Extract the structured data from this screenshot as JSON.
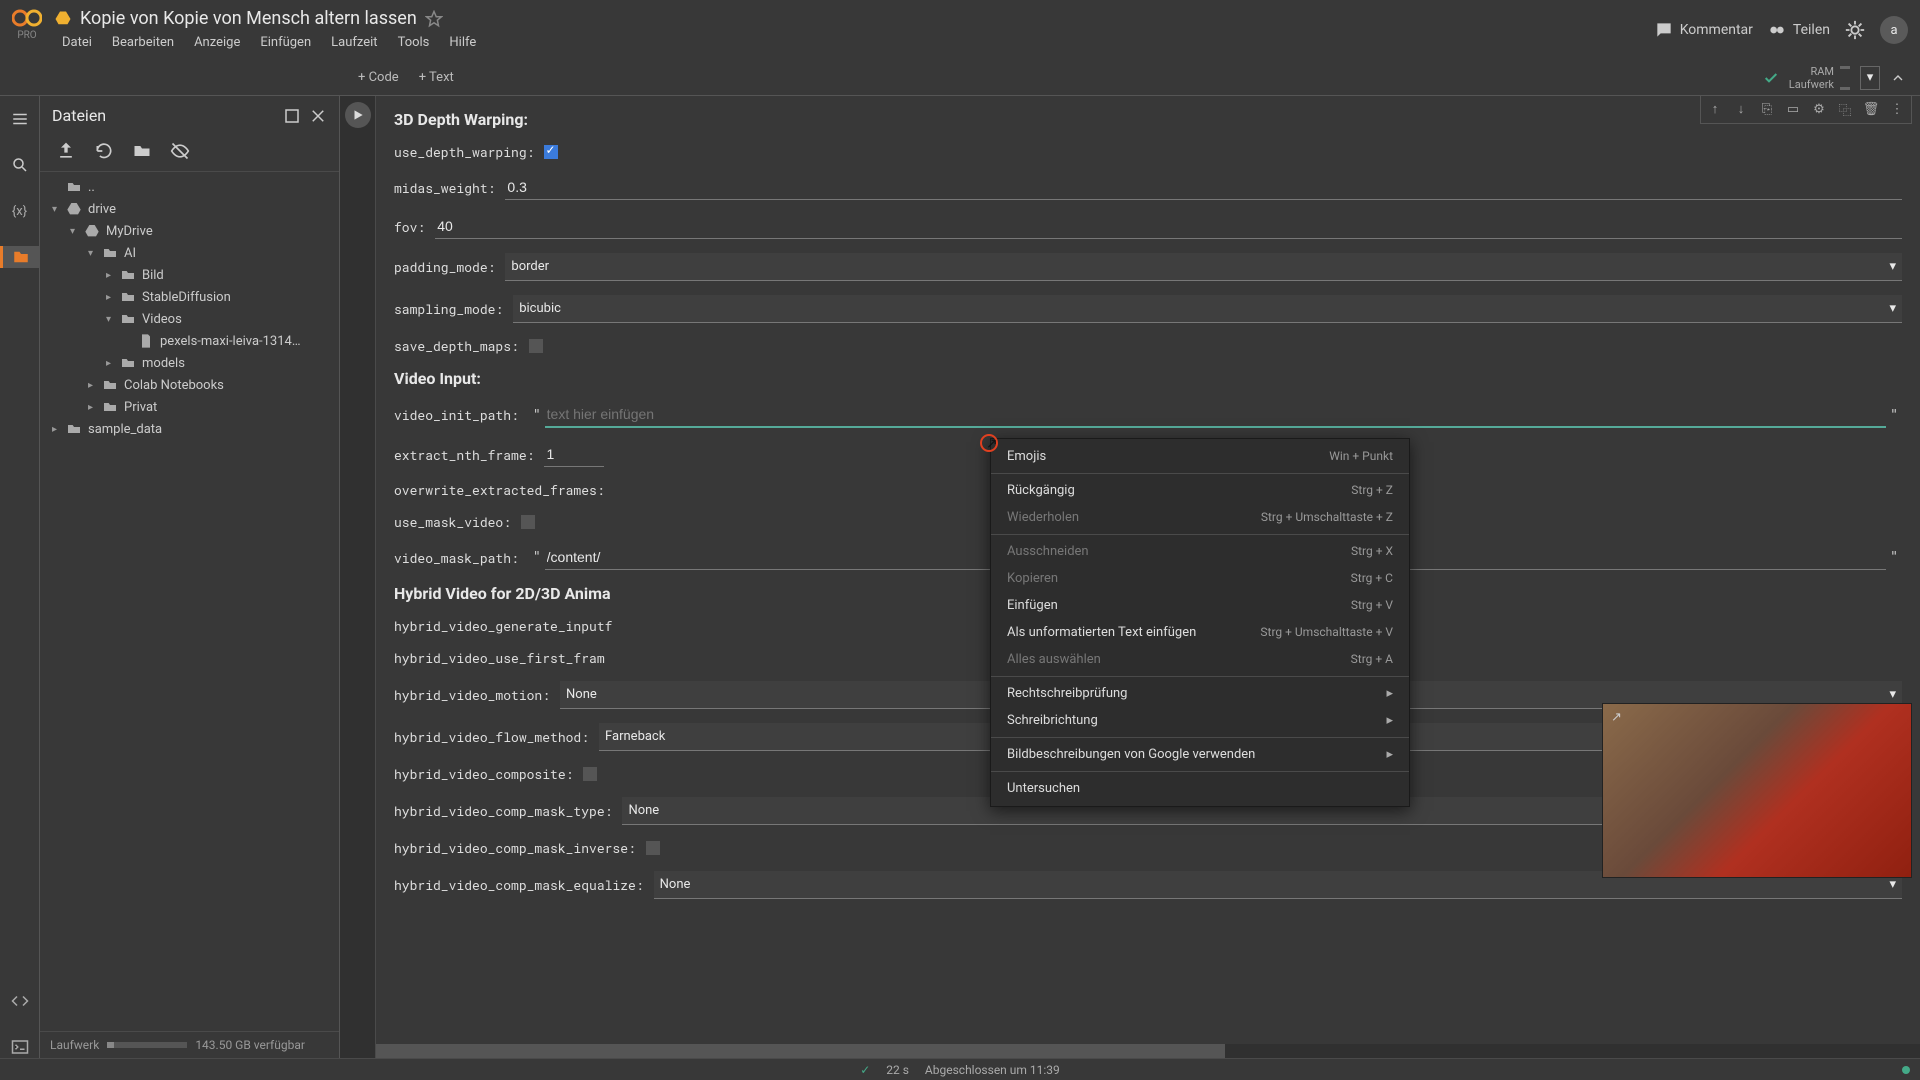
{
  "header": {
    "pro": "PRO",
    "title": "Kopie von Kopie von Mensch altern lassen",
    "menus": [
      "Datei",
      "Bearbeiten",
      "Anzeige",
      "Einfügen",
      "Laufzeit",
      "Tools",
      "Hilfe"
    ],
    "kommentar": "Kommentar",
    "teilen": "Teilen",
    "avatar": "a",
    "ram_label": "RAM",
    "laufwerk_label": "Laufwerk"
  },
  "toolbar": {
    "code": "+ Code",
    "text": "+ Text"
  },
  "files": {
    "title": "Dateien",
    "footer_label": "Laufwerk",
    "footer_free": "143.50 GB verfügbar",
    "tree": [
      {
        "depth": 0,
        "caret": "",
        "icon": "folder",
        "label": ".."
      },
      {
        "depth": 0,
        "caret": "▾",
        "icon": "drive",
        "label": "drive"
      },
      {
        "depth": 1,
        "caret": "▾",
        "icon": "drive",
        "label": "MyDrive"
      },
      {
        "depth": 2,
        "caret": "▾",
        "icon": "folder",
        "label": "AI"
      },
      {
        "depth": 3,
        "caret": "▸",
        "icon": "folder",
        "label": "Bild"
      },
      {
        "depth": 3,
        "caret": "▸",
        "icon": "folder",
        "label": "StableDiffusion"
      },
      {
        "depth": 3,
        "caret": "▾",
        "icon": "folder",
        "label": "Videos"
      },
      {
        "depth": 4,
        "caret": "",
        "icon": "file",
        "label": "pexels-maxi-leiva-1314…"
      },
      {
        "depth": 3,
        "caret": "▸",
        "icon": "folder",
        "label": "models"
      },
      {
        "depth": 2,
        "caret": "▸",
        "icon": "folder",
        "label": "Colab Notebooks"
      },
      {
        "depth": 2,
        "caret": "▸",
        "icon": "folder",
        "label": "Privat"
      },
      {
        "depth": 0,
        "caret": "▸",
        "icon": "folder",
        "label": "sample_data"
      }
    ]
  },
  "form": {
    "section1": "3D Depth Warping:",
    "use_depth_warping": "use_depth_warping:",
    "midas_weight": {
      "label": "midas_weight:",
      "value": "0.3"
    },
    "fov": {
      "label": "fov:",
      "value": "40"
    },
    "padding_mode": {
      "label": "padding_mode:",
      "value": "border"
    },
    "sampling_mode": {
      "label": "sampling_mode:",
      "value": "bicubic"
    },
    "save_depth_maps": "save_depth_maps:",
    "section2": "Video Input:",
    "video_init_path": {
      "label": "video_init_path:",
      "placeholder": "text hier einfügen"
    },
    "extract_nth_frame": {
      "label": "extract_nth_frame:",
      "value": "1"
    },
    "overwrite_extracted_frames": "overwrite_extracted_frames:",
    "use_mask_video": "use_mask_video:",
    "video_mask_path": {
      "label": "video_mask_path:",
      "value": "/content/"
    },
    "section3": "Hybrid Video for 2D/3D Anima",
    "hybrid_video_generate_inputf": "hybrid_video_generate_inputf",
    "hybrid_video_use_first_fram": "hybrid_video_use_first_fram",
    "hybrid_video_motion": {
      "label": "hybrid_video_motion:",
      "value": "None"
    },
    "hybrid_video_flow_method": {
      "label": "hybrid_video_flow_method:",
      "value": "Farneback"
    },
    "hybrid_video_composite": "hybrid_video_composite:",
    "hybrid_video_comp_mask_type": {
      "label": "hybrid_video_comp_mask_type:",
      "value": "None"
    },
    "hybrid_video_comp_mask_inverse": "hybrid_video_comp_mask_inverse:",
    "hybrid_video_comp_mask_equalize": {
      "label": "hybrid_video_comp_mask_equalize:",
      "value": "None"
    }
  },
  "context_menu": [
    {
      "type": "item",
      "label": "Emojis",
      "shortcut": "Win + Punkt"
    },
    {
      "type": "sep"
    },
    {
      "type": "item",
      "label": "Rückgängig",
      "shortcut": "Strg + Z"
    },
    {
      "type": "item",
      "label": "Wiederholen",
      "shortcut": "Strg + Umschalttaste + Z",
      "disabled": true
    },
    {
      "type": "sep"
    },
    {
      "type": "item",
      "label": "Ausschneiden",
      "shortcut": "Strg + X",
      "disabled": true
    },
    {
      "type": "item",
      "label": "Kopieren",
      "shortcut": "Strg + C",
      "disabled": true
    },
    {
      "type": "item",
      "label": "Einfügen",
      "shortcut": "Strg + V"
    },
    {
      "type": "item",
      "label": "Als unformatierten Text einfügen",
      "shortcut": "Strg + Umschalttaste + V"
    },
    {
      "type": "item",
      "label": "Alles auswählen",
      "shortcut": "Strg + A",
      "disabled": true
    },
    {
      "type": "sep"
    },
    {
      "type": "item",
      "label": "Rechtschreibprüfung",
      "arrow": true
    },
    {
      "type": "item",
      "label": "Schreibrichtung",
      "arrow": true
    },
    {
      "type": "sep"
    },
    {
      "type": "item",
      "label": "Bildbeschreibungen von Google verwenden",
      "arrow": true
    },
    {
      "type": "sep"
    },
    {
      "type": "item",
      "label": "Untersuchen"
    }
  ],
  "status": {
    "time": "22 s",
    "completed": "Abgeschlossen um 11:39"
  }
}
